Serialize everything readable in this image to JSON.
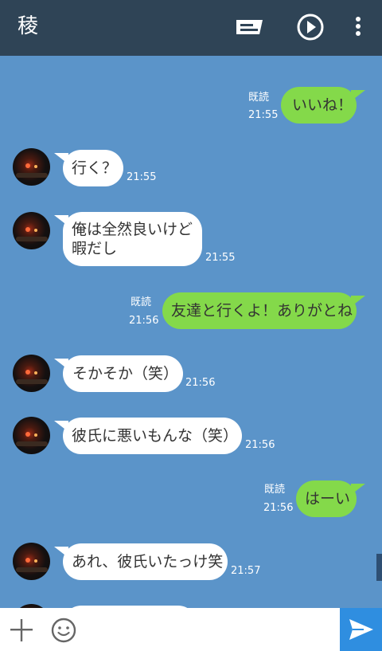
{
  "header": {
    "title": "稜",
    "icons": [
      "chat-bubble-icon",
      "play-icon",
      "more-vertical-icon"
    ]
  },
  "messages": [
    {
      "side": "out",
      "text": "いいね！",
      "time": "21:55",
      "read": "既読"
    },
    {
      "side": "in",
      "text": "行く？",
      "time": "21:55"
    },
    {
      "side": "in",
      "line1": "俺は全然良いけど",
      "line2": "暇だし",
      "time": "21:55"
    },
    {
      "side": "out",
      "text": "友達と行くよ！ありがとね",
      "time": "21:56",
      "read": "既読"
    },
    {
      "side": "in",
      "text": "そかそか（笑）",
      "time": "21:56"
    },
    {
      "side": "in",
      "text": "彼氏に悪いもんな（笑）",
      "time": "21:56"
    },
    {
      "side": "out",
      "text": "はーい",
      "time": "21:56",
      "read": "既読"
    },
    {
      "side": "in",
      "text": "あれ、彼氏いたっけ笑",
      "time": "21:57"
    }
  ],
  "input": {
    "value": "",
    "icons": [
      "plus-icon",
      "emoji-icon",
      "send-icon"
    ]
  },
  "colors": {
    "header_bg": "#2f4456",
    "chat_bg": "#5b94c9",
    "outgoing_bubble": "#84d94a",
    "incoming_bubble": "#ffffff",
    "send_button": "#2f8ee0"
  }
}
